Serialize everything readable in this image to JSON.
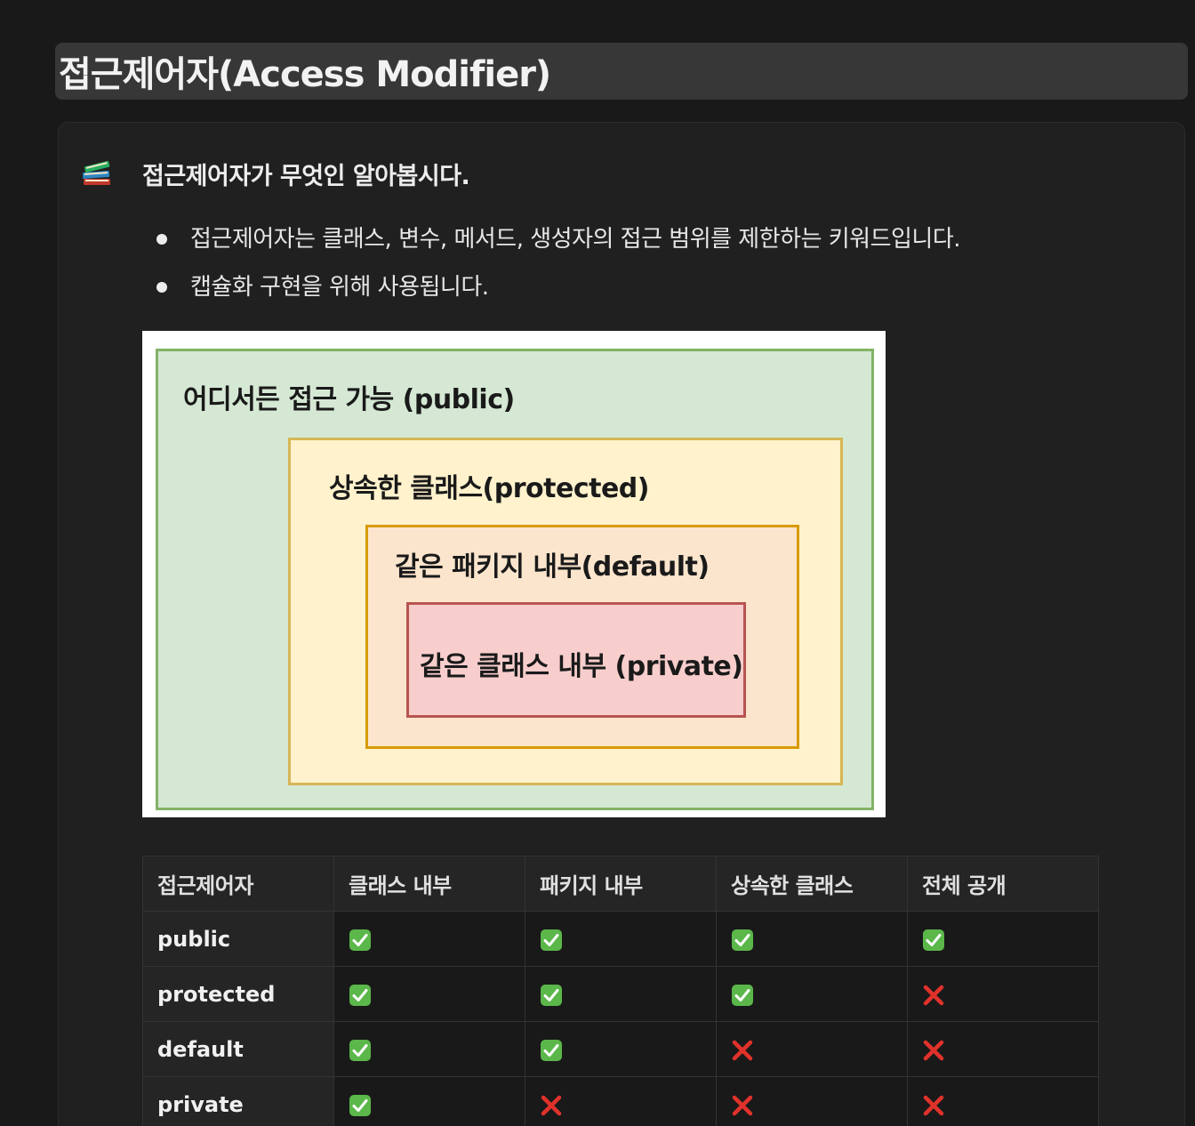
{
  "heading": "접근제어자(Access Modifier)",
  "callout": {
    "icon": "books-icon",
    "title": "접근제어자가 무엇인 알아봅시다.",
    "bullets": [
      "접근제어자는 클래스, 변수, 메서드, 생성자의 접근 범위를 제한하는 키워드입니다.",
      "캡슐화 구현을 위해 사용됩니다."
    ]
  },
  "diagram": {
    "public": "어디서든 접근 가능 (public)",
    "protected": "상속한 클래스(protected)",
    "default": "같은 패키지 내부(default)",
    "private": "같은 클래스 내부 (private)",
    "colors": {
      "public_fill": "#d5e8d4",
      "public_border": "#82b366",
      "protected_fill": "#fff2cc",
      "protected_border": "#d6b656",
      "default_fill": "#fce5cd",
      "default_border": "#d79b00",
      "private_fill": "#f8cecc",
      "private_border": "#b85450"
    }
  },
  "table": {
    "headers": [
      "접근제어자",
      "클래스 내부",
      "패키지 내부",
      "상속한 클래스",
      "전체 공개"
    ],
    "rows": [
      {
        "name": "public",
        "access": [
          true,
          true,
          true,
          true
        ]
      },
      {
        "name": "protected",
        "access": [
          true,
          true,
          true,
          false
        ]
      },
      {
        "name": "default",
        "access": [
          true,
          true,
          false,
          false
        ]
      },
      {
        "name": "private",
        "access": [
          true,
          false,
          false,
          false
        ]
      }
    ],
    "yes_icon": "check-mark-button-icon",
    "no_icon": "cross-mark-icon"
  }
}
